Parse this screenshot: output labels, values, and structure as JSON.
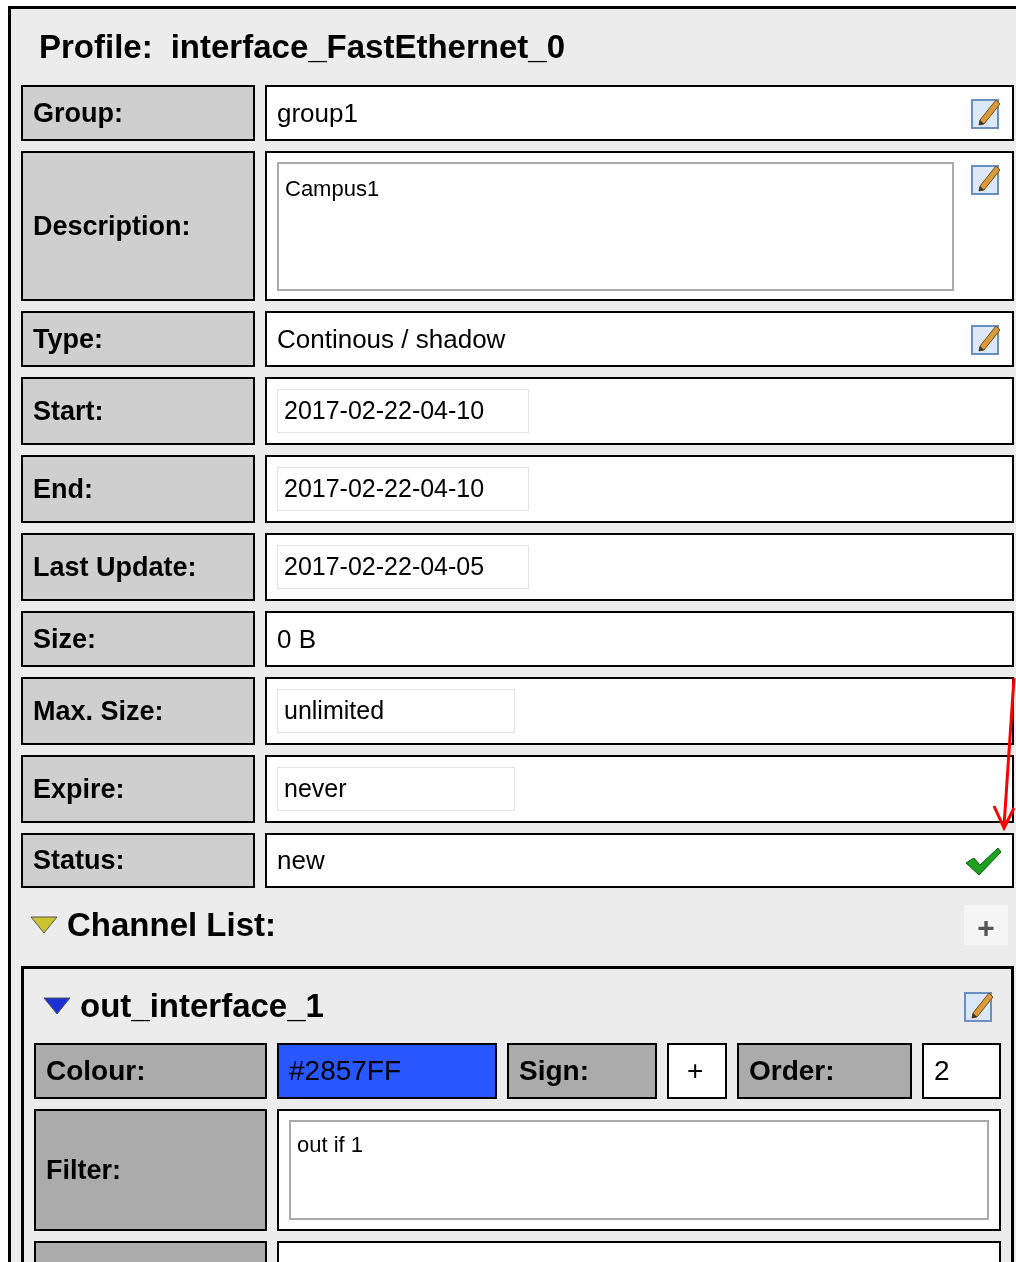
{
  "profile": {
    "label": "Profile:",
    "name": "interface_FastEthernet_0"
  },
  "rows": [
    {
      "label": "Group:",
      "kind": "text",
      "value": "group1",
      "editable": true
    },
    {
      "label": "Description:",
      "kind": "textarea",
      "value": "Campus1",
      "editable": true
    },
    {
      "label": "Type:",
      "kind": "text",
      "value": "Continous / shadow",
      "editable": true
    },
    {
      "label": "Start:",
      "kind": "field",
      "value": "2017-02-22-04-10",
      "editable": false
    },
    {
      "label": "End:",
      "kind": "field",
      "value": "2017-02-22-04-10",
      "editable": false
    },
    {
      "label": "Last Update:",
      "kind": "field",
      "value": "2017-02-22-04-05",
      "editable": false
    },
    {
      "label": "Size:",
      "kind": "text",
      "value": "0 B",
      "editable": false
    },
    {
      "label": "Max. Size:",
      "kind": "short_field",
      "value": "unlimited",
      "editable": false
    },
    {
      "label": "Expire:",
      "kind": "short_field",
      "value": "never",
      "editable": false
    },
    {
      "label": "Status:",
      "kind": "status",
      "value": "new",
      "editable": false,
      "ok": true
    }
  ],
  "channel_list": {
    "title": "Channel List:",
    "expanded": true,
    "add_button": "+",
    "channels": [
      {
        "name": "out_interface_1",
        "expanded": true,
        "colour_label": "Colour:",
        "colour_text": "#2857FF",
        "sign_label": "Sign:",
        "sign": "+",
        "order_label": "Order:",
        "order": "2",
        "filter_label": "Filter:",
        "filter": "out if 1"
      }
    ]
  }
}
